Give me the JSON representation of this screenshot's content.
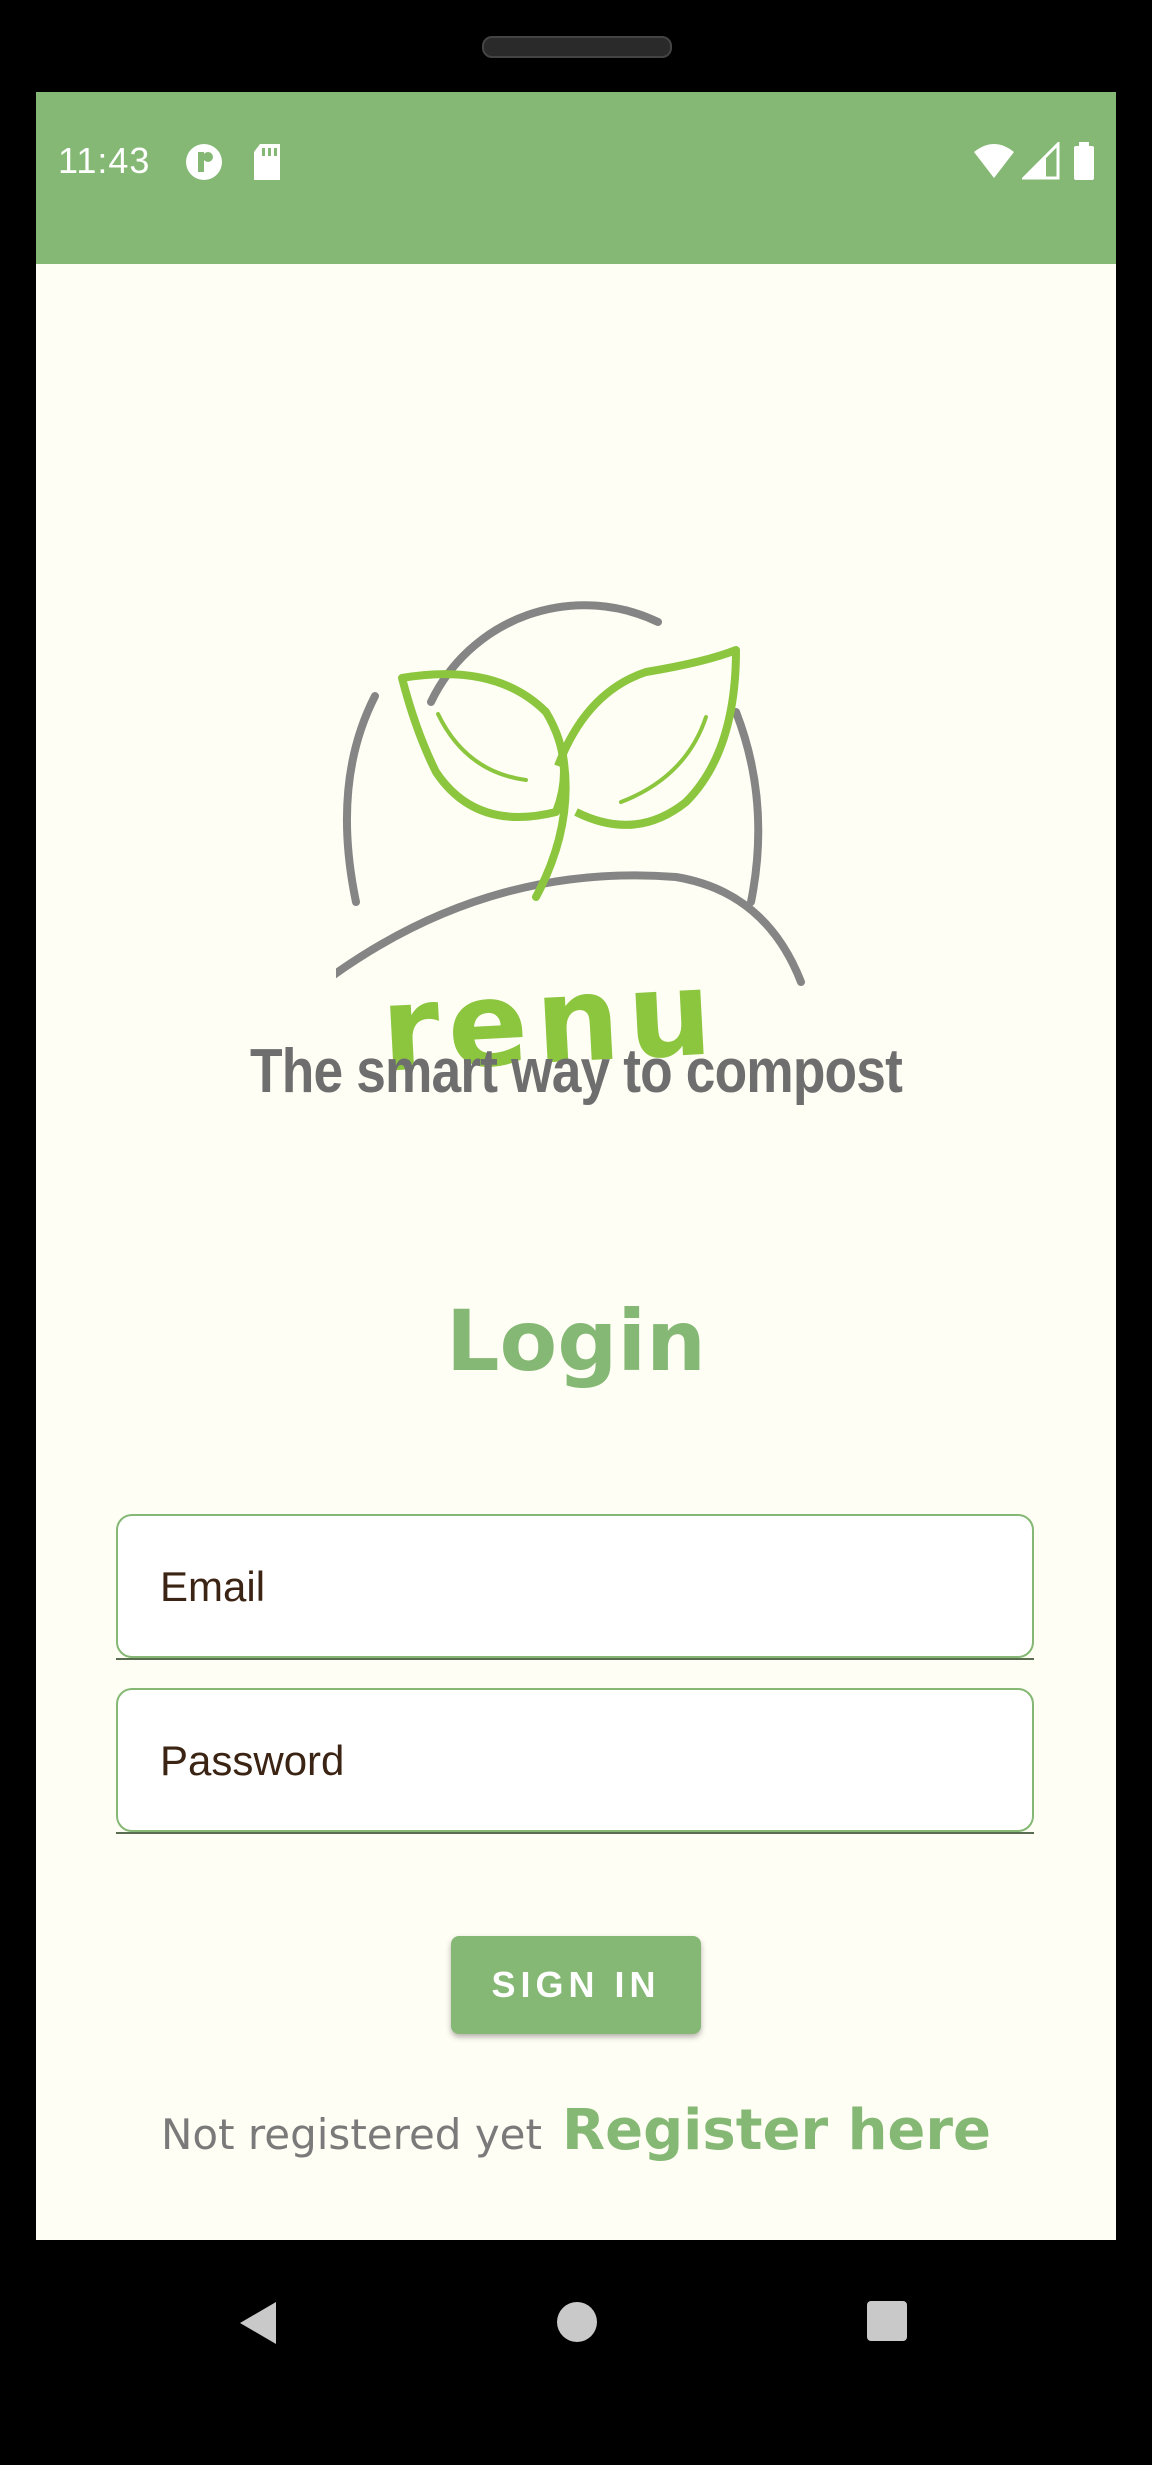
{
  "status_bar": {
    "time": "11:43",
    "left_icons": [
      "circle-p-icon",
      "sd-card-icon"
    ],
    "right_icons": [
      "wifi-icon",
      "signal-icon",
      "battery-icon"
    ]
  },
  "logo": {
    "text": "renu"
  },
  "tagline": "The smart way to compost",
  "login": {
    "title": "Login",
    "email_placeholder": "Email",
    "password_placeholder": "Password",
    "sign_in_label": "SIGN IN",
    "register_prompt": "Not registered yet",
    "register_link": "Register here"
  },
  "nav_bar": {
    "buttons": [
      "back-icon",
      "home-icon",
      "recents-icon"
    ]
  },
  "colors": {
    "accent": "#84b874",
    "leaf_green": "#8cc63f",
    "background": "#fffef4",
    "text_gray": "#6e6e6e"
  }
}
